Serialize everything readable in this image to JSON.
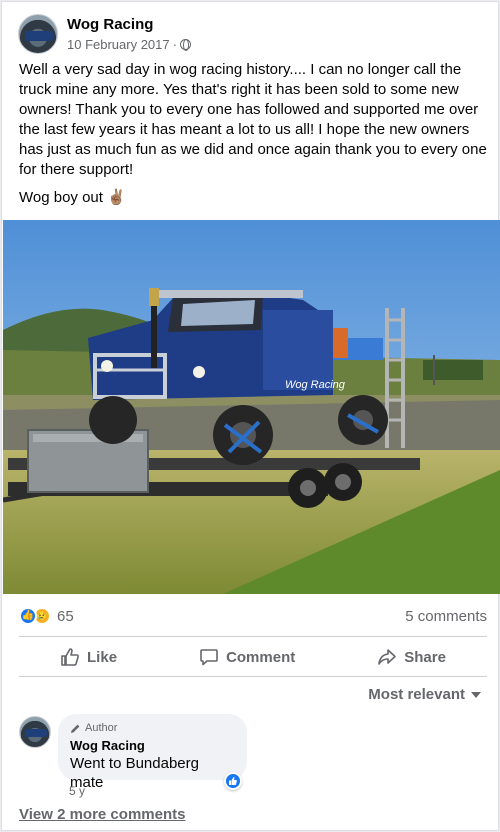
{
  "post": {
    "page_name": "Wog Racing",
    "date": "10 February 2017",
    "separator": "·",
    "body": "Well a very sad day in wog racing history.... I can no longer call the truck mine any more. Yes that's right it has been sold to some new owners! Thank you to every one has followed and supported me over the last few years it has meant a lot to us all! I hope the new owners has just as much fun as we did and once again thank you to every one for there support!",
    "signoff": "Wog boy out",
    "signoff_emoji": "✌🏽",
    "photo_sticker_text": "Wog Racing"
  },
  "stats": {
    "reaction_count": "65",
    "comments": "5 comments",
    "reactions": [
      "like-icon",
      "sad-icon"
    ]
  },
  "actions": {
    "like": "Like",
    "comment": "Comment",
    "share": "Share"
  },
  "filter": {
    "label": "Most relevant"
  },
  "comment": {
    "badge": "Author",
    "name": "Wog Racing",
    "text": "Went to Bundaberg mate",
    "time": "5 y"
  },
  "more_comments": "View 2 more comments",
  "colors": {
    "accent": "#1877f2",
    "secondary_text": "#65676b",
    "bubble": "#f0f2f5"
  }
}
